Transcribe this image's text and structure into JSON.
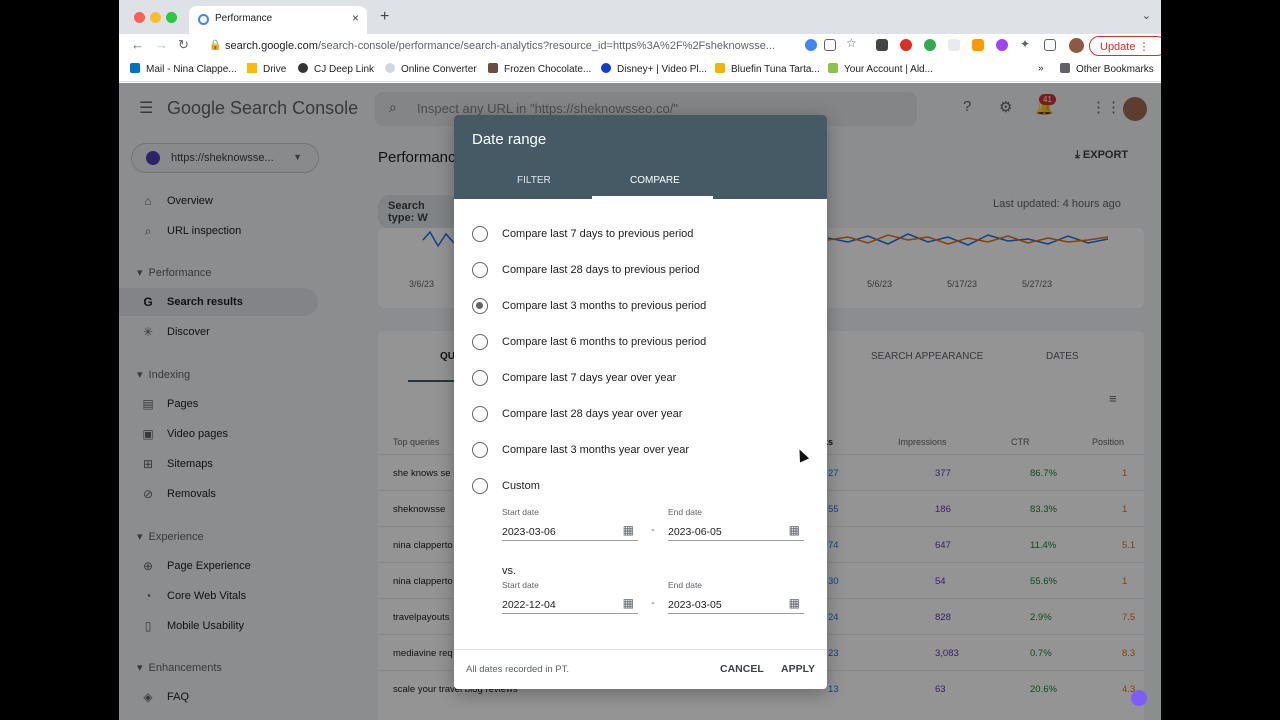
{
  "browser": {
    "tab_title": "Performance",
    "tab_close": "×",
    "new_tab": "+",
    "tabs_dropdown": "⌄",
    "url_host": "search.google.com",
    "url_path": "/search-console/performance/search-analytics?resource_id=https%3A%2F%2Fsheknowsse...",
    "update_label": "Update",
    "bookmarks": [
      "Mail - Nina Clappe...",
      "Drive",
      "CJ Deep Link",
      "Online Converter",
      "Frozen Chocolate...",
      "Disney+ | Video Pl...",
      "Bluefin Tuna Tarta...",
      "Your Account | Ald..."
    ],
    "other_bookmarks": "Other Bookmarks",
    "more_bookmarks": "»"
  },
  "app": {
    "logo_text": "Google Search Console",
    "search_placeholder": "Inspect any URL in \"https://sheknowsseo.co/\"",
    "notification_count": "41",
    "property": "https://sheknowsse...",
    "nav": {
      "overview": "Overview",
      "url_inspection": "URL inspection",
      "performance_section": "Performance",
      "search_results": "Search results",
      "discover": "Discover",
      "indexing_section": "Indexing",
      "pages": "Pages",
      "video_pages": "Video pages",
      "sitemaps": "Sitemaps",
      "removals": "Removals",
      "experience_section": "Experience",
      "page_experience": "Page Experience",
      "core_web_vitals": "Core Web Vitals",
      "mobile_usability": "Mobile Usability",
      "enhancements_section": "Enhancements",
      "faq": "FAQ"
    },
    "main": {
      "title": "Performance",
      "export": "EXPORT",
      "search_type": "Search type: W",
      "last_updated": "Last updated: 4 hours ago",
      "chart_ticks": [
        "3/6/23",
        "5/6/23",
        "5/17/23",
        "5/27/23"
      ],
      "tabs": [
        "QU",
        "SEARCH APPEARANCE",
        "DATES"
      ],
      "columns": [
        "Top queries",
        "ks",
        "Impressions",
        "CTR",
        "Position"
      ],
      "rows": [
        {
          "q": "she knows se",
          "c": "27",
          "i": "377",
          "ctr": "86.7%",
          "p": "1"
        },
        {
          "q": "sheknowsse",
          "c": "55",
          "i": "186",
          "ctr": "83.3%",
          "p": "1"
        },
        {
          "q": "nina clapperto",
          "c": "74",
          "i": "647",
          "ctr": "11.4%",
          "p": "5.1"
        },
        {
          "q": "nina clapperto",
          "c": "30",
          "i": "54",
          "ctr": "55.6%",
          "p": "1"
        },
        {
          "q": "travelpayouts",
          "c": "24",
          "i": "828",
          "ctr": "2.9%",
          "p": "7.5"
        },
        {
          "q": "mediavine req",
          "c": "23",
          "i": "3,083",
          "ctr": "0.7%",
          "p": "8.3"
        },
        {
          "q": "scale your travel blog reviews",
          "c": "13",
          "i": "63",
          "ctr": "20.6%",
          "p": "4.3"
        }
      ]
    }
  },
  "dialog": {
    "title": "Date range",
    "tab_filter": "FILTER",
    "tab_compare": "COMPARE",
    "options": [
      "Compare last 7 days to previous period",
      "Compare last 28 days to previous period",
      "Compare last 3 months to previous period",
      "Compare last 6 months to previous period",
      "Compare last 7 days year over year",
      "Compare last 28 days year over year",
      "Compare last 3 months year over year",
      "Custom"
    ],
    "selected_option": "Compare last 3 months to previous period",
    "start_label": "Start date",
    "end_label": "End date",
    "range1_start": "2023-03-06",
    "range1_end": "2023-06-05",
    "vs_label": "vs.",
    "range2_start": "2022-12-04",
    "range2_end": "2023-03-05",
    "dash": "-",
    "footnote": "All dates recorded in PT.",
    "cancel": "CANCEL",
    "apply": "APPLY"
  },
  "colors": {
    "dialog_header": "#455a64",
    "clicks": "#1a73e8",
    "impressions": "#5e35b1",
    "ctr": "#188038",
    "position": "#e8710a"
  }
}
